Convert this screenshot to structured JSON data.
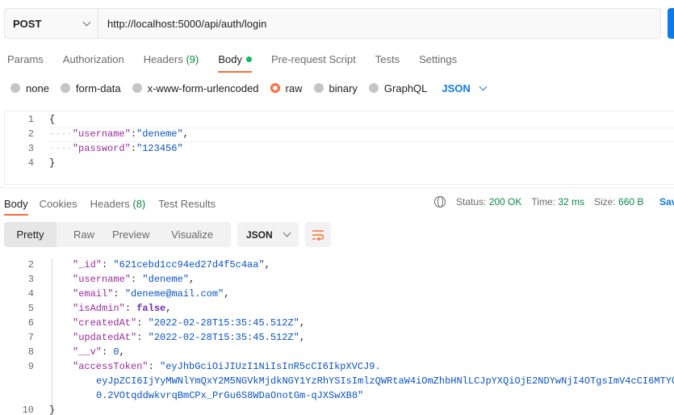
{
  "request": {
    "method": "POST",
    "url": "http://localhost:5000/api/auth/login"
  },
  "request_tabs": [
    {
      "label": "Params"
    },
    {
      "label": "Authorization"
    },
    {
      "label": "Headers",
      "count": "(9)"
    },
    {
      "label": "Body",
      "active": true
    },
    {
      "label": "Pre-request Script"
    },
    {
      "label": "Tests"
    },
    {
      "label": "Settings"
    }
  ],
  "body_types": [
    "none",
    "form-data",
    "x-www-form-urlencoded",
    "raw",
    "binary",
    "GraphQL"
  ],
  "body_selected": "raw",
  "body_format": "JSON",
  "request_body": {
    "line_numbers": [
      "1",
      "2",
      "3",
      "4"
    ],
    "open_brace": "{",
    "close_brace": "}",
    "fields": [
      {
        "key": "\"username\"",
        "value": "\"deneme\"",
        "trail": ","
      },
      {
        "key": "\"password\"",
        "value": "\"123456\"",
        "trail": ""
      }
    ]
  },
  "response_tabs": [
    {
      "label": "Body",
      "active": true
    },
    {
      "label": "Cookies"
    },
    {
      "label": "Headers",
      "count": "(8)"
    },
    {
      "label": "Test Results"
    }
  ],
  "response_status": {
    "status_label": "Status:",
    "status_value": "200 OK",
    "time_label": "Time:",
    "time_value": "32 ms",
    "size_label": "Size:",
    "size_value": "660 B",
    "save_label": "Sav"
  },
  "view_tabs": [
    "Pretty",
    "Raw",
    "Preview",
    "Visualize"
  ],
  "response_format": "JSON",
  "response_body": {
    "line_numbers": [
      "2",
      "3",
      "4",
      "5",
      "6",
      "7",
      "8",
      "9",
      "10"
    ],
    "lines": [
      {
        "key": "\"_id\"",
        "value": "\"621cebd1cc94ed27d4f5c4aa\"",
        "type": "str",
        "trail": ","
      },
      {
        "key": "\"username\"",
        "value": "\"deneme\"",
        "type": "str",
        "trail": ","
      },
      {
        "key": "\"email\"",
        "value": "\"deneme@mail.com\"",
        "type": "str",
        "trail": ","
      },
      {
        "key": "\"isAdmin\"",
        "value": "false",
        "type": "kw",
        "trail": ","
      },
      {
        "key": "\"createdAt\"",
        "value": "\"2022-02-28T15:35:45.512Z\"",
        "type": "str",
        "trail": ","
      },
      {
        "key": "\"updatedAt\"",
        "value": "\"2022-02-28T15:35:45.512Z\"",
        "type": "str",
        "trail": ","
      },
      {
        "key": "\"__v\"",
        "value": "0",
        "type": "num",
        "trail": ","
      }
    ],
    "token_key": "\"accessToken\"",
    "token_lines": [
      "\"eyJhbGciOiJIUzI1NiIsInR5cCI6IkpXVCJ9.",
      "eyJpZCI6IjYyMWNlYmQxY2M5NGVkMjdkNGY1YzRhYSIsImlzQWRtaW4iOmZhbHNlLCJpYXQiOjE2NDYwNjI4OTgsImV4cCI6MTYG",
      "0.2VOtqddwkvrqBmCPx_PrGu6S8WDaOnotGm-qJXSwXB8\""
    ],
    "close_brace": "}"
  }
}
